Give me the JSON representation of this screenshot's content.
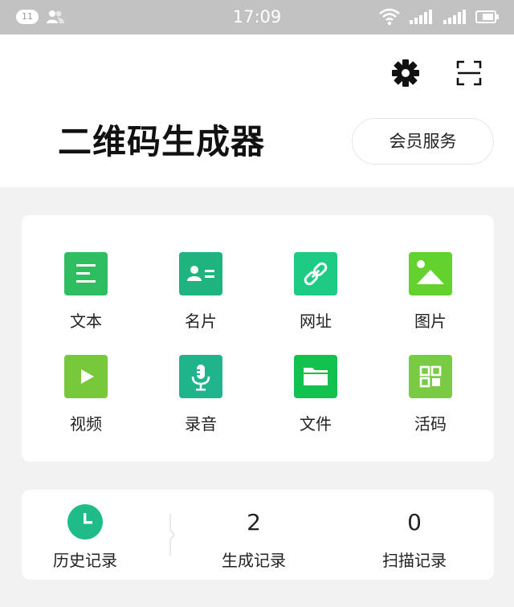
{
  "status_bar": {
    "notification_count": "11",
    "time": "17:09"
  },
  "header": {
    "title": "二维码生成器",
    "vip_button": "会员服务"
  },
  "grid": [
    {
      "label": "文本",
      "icon": "text-icon",
      "color": "#2fbe5f"
    },
    {
      "label": "名片",
      "icon": "business-card-icon",
      "color": "#1fb380"
    },
    {
      "label": "网址",
      "icon": "link-icon",
      "color": "#1ecb84"
    },
    {
      "label": "图片",
      "icon": "image-icon",
      "color": "#63d12e"
    },
    {
      "label": "视频",
      "icon": "video-icon",
      "color": "#77c83a"
    },
    {
      "label": "录音",
      "icon": "microphone-icon",
      "color": "#1fb48c"
    },
    {
      "label": "文件",
      "icon": "folder-icon",
      "color": "#12c14e"
    },
    {
      "label": "活码",
      "icon": "live-code-icon",
      "color": "#7acb44"
    }
  ],
  "stats": {
    "history_label": "历史记录",
    "generated_count": "2",
    "generated_label": "生成记录",
    "scanned_count": "0",
    "scanned_label": "扫描记录"
  },
  "colors": {
    "status_bar": "#c2c2c2",
    "history_icon": "#1fbc8a",
    "page_bg": "#f2f2f2"
  }
}
